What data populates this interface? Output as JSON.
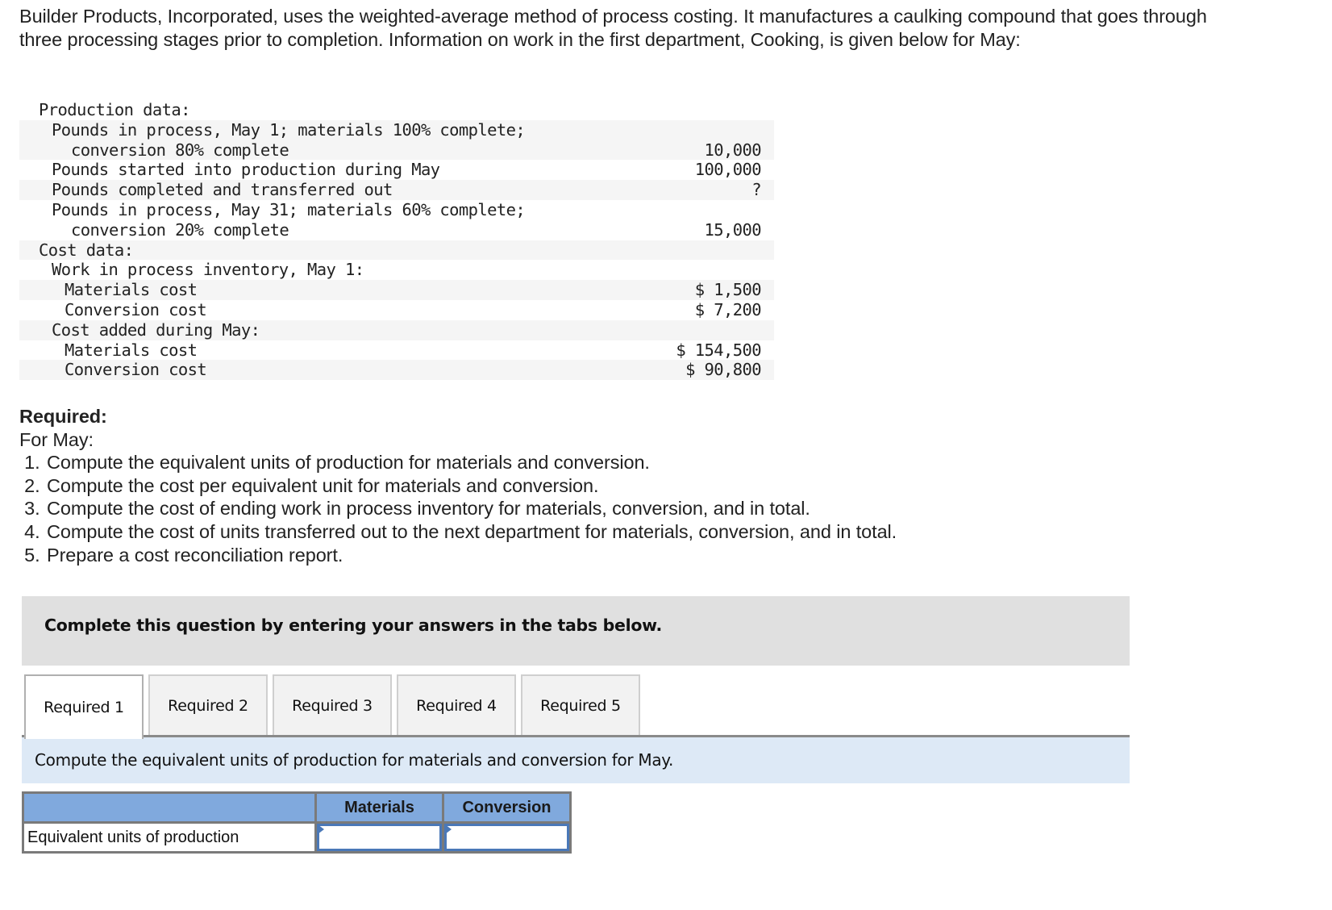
{
  "intro": {
    "text": "Builder Products, Incorporated, uses the weighted-average method of process costing. It manufactures a caulking compound that goes through three processing stages prior to completion. Information on work in the first department, Cooking, is given below for May:"
  },
  "data_table": {
    "rows": [
      {
        "label": "Production data:",
        "value": "",
        "indent": 0,
        "shade": false
      },
      {
        "label": "Pounds in process, May 1; materials 100% complete;",
        "value": "",
        "indent": 1,
        "shade": true
      },
      {
        "label": "conversion 80% complete",
        "value": "10,000",
        "indent": 3,
        "shade": true
      },
      {
        "label": "Pounds started into production during May",
        "value": "100,000",
        "indent": 1,
        "shade": false
      },
      {
        "label": "Pounds completed and transferred out",
        "value": "?",
        "indent": 1,
        "shade": true
      },
      {
        "label": "Pounds in process, May 31; materials 60% complete;",
        "value": "",
        "indent": 1,
        "shade": false
      },
      {
        "label": "conversion 20% complete",
        "value": "15,000",
        "indent": 3,
        "shade": false
      },
      {
        "label": "Cost data:",
        "value": "",
        "indent": 0,
        "shade": true
      },
      {
        "label": "Work in process inventory, May 1:",
        "value": "",
        "indent": 1,
        "shade": false
      },
      {
        "label": "Materials cost",
        "value": "$ 1,500",
        "indent": 2,
        "shade": true
      },
      {
        "label": "Conversion cost",
        "value": "$ 7,200",
        "indent": 2,
        "shade": false
      },
      {
        "label": "Cost added during May:",
        "value": "",
        "indent": 1,
        "shade": true
      },
      {
        "label": "Materials cost",
        "value": "$ 154,500",
        "indent": 2,
        "shade": false
      },
      {
        "label": "Conversion cost",
        "value": "$ 90,800",
        "indent": 2,
        "shade": true
      }
    ]
  },
  "required": {
    "heading": "Required:",
    "subheading": "For May:",
    "items": [
      "Compute the equivalent units of production for materials and conversion.",
      "Compute the cost per equivalent unit for materials and conversion.",
      "Compute the cost of ending work in process inventory for materials, conversion, and in total.",
      "Compute the cost of units transferred out to the next department for materials, conversion, and in total.",
      "Prepare a cost reconciliation report."
    ]
  },
  "banner": {
    "text": "Complete this question by entering your answers in the tabs below."
  },
  "tabs": {
    "active_index": 0,
    "items": [
      "Required 1",
      "Required 2",
      "Required 3",
      "Required 4",
      "Required 5"
    ]
  },
  "instruction": {
    "text": "Compute the equivalent units of production for materials and conversion for May."
  },
  "answer_table": {
    "headers": [
      "",
      "Materials",
      "Conversion"
    ],
    "row_label": "Equivalent units of production",
    "materials_value": "",
    "conversion_value": ""
  },
  "colors": {
    "banner_bg": "#e0e0e0",
    "instruction_bg": "#dde9f6",
    "table_header_bg": "#80a9dd",
    "input_border": "#4a78b8"
  }
}
